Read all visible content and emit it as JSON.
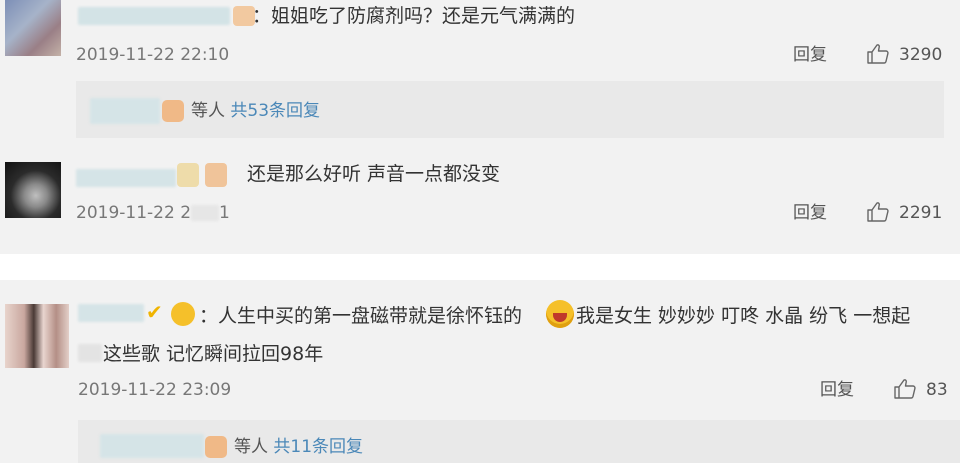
{
  "comments": [
    {
      "text": "：姐姐吃了防腐剂吗？还是元气满满的",
      "timestamp": "2019-11-22 22:10",
      "reply_label": "回复",
      "likes": "3290",
      "replies": {
        "who": "等人",
        "count_text": "共53条回复"
      }
    },
    {
      "text": "还是那么好听 声音一点都没变",
      "timestamp": "2019-11-22 2",
      "timestamp_suffix": "1",
      "reply_label": "回复",
      "likes": "2291"
    },
    {
      "text_line1a": "：人生中买的第一盘磁带就是徐怀钰的",
      "text_line1b": "我是女生 妙妙妙 叮咚 水晶 纷飞 一想起",
      "text_line2": "这些歌 记忆瞬间拉回98年",
      "timestamp": "2019-11-22 23:09",
      "reply_label": "回复",
      "likes": "83",
      "replies": {
        "who": "等人",
        "count_text": "共11条回复"
      }
    }
  ],
  "colors": {
    "link": "#4b88b8",
    "verified_badge": "#f0b400",
    "emoji": "#f5c02a"
  }
}
